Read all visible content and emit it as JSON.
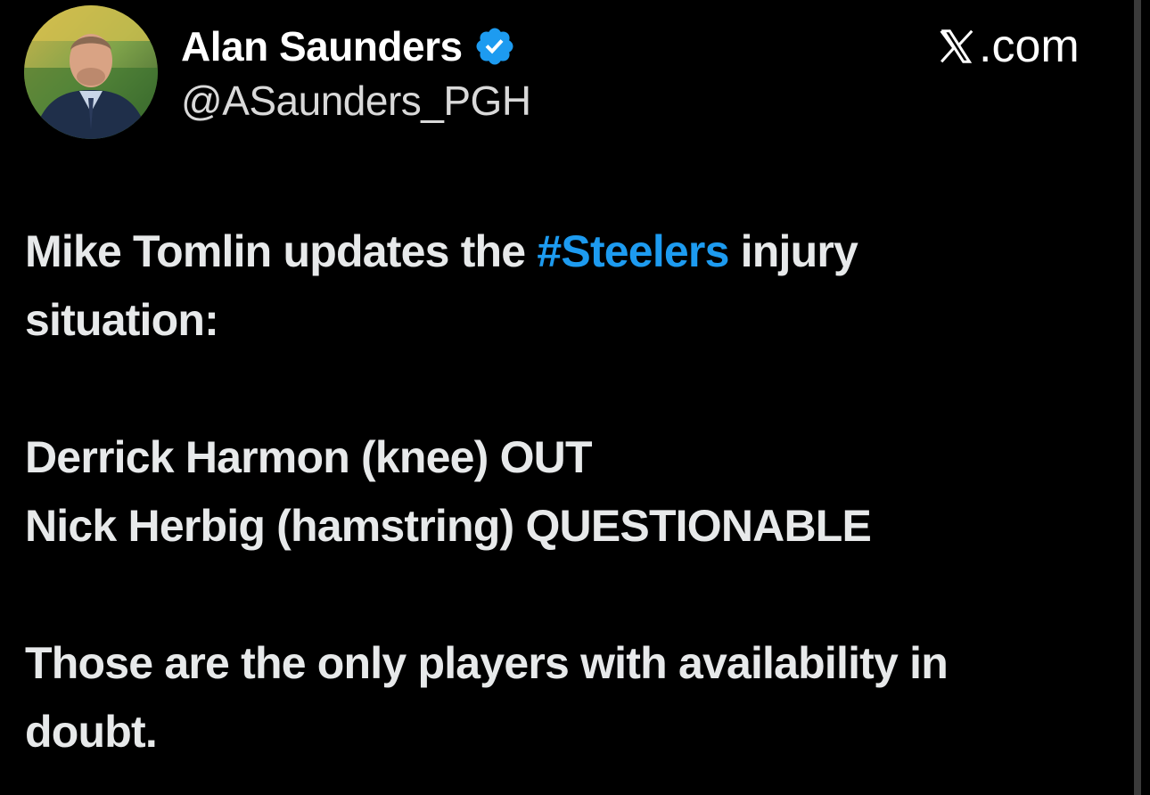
{
  "colors": {
    "background": "#000000",
    "text": "#e7e9ea",
    "link": "#1d9bf0",
    "verified": "#1d9bf0"
  },
  "header": {
    "display_name": "Alan Saunders",
    "handle": "@ASaunders_PGH",
    "verified_icon": "verified-badge-icon",
    "brand_suffix": ".com",
    "brand_icon": "x-logo-icon",
    "avatar_icon": "profile-photo"
  },
  "tweet": {
    "line1_before": "Mike Tomlin updates the ",
    "hashtag": "#Steelers",
    "line1_after": " injury",
    "line2": "situation:",
    "injury1": "Derrick Harmon (knee) OUT",
    "injury2": "Nick Herbig (hamstring) QUESTIONABLE",
    "closing_line1": "Those are the only players with availability in",
    "closing_line2": "doubt."
  }
}
